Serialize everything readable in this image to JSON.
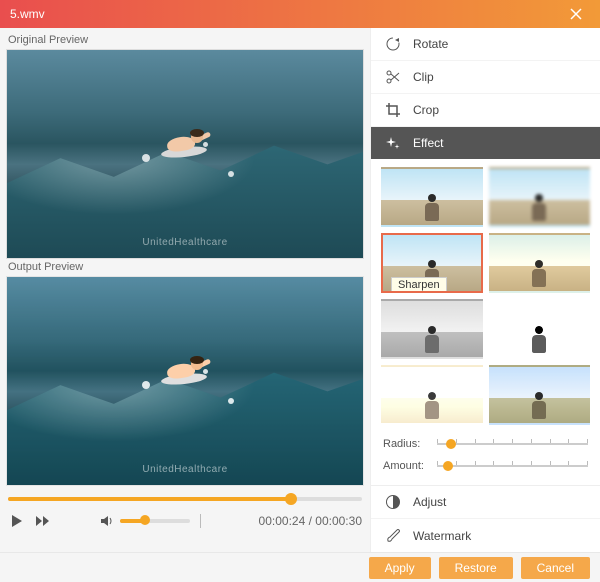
{
  "titlebar": {
    "title": "5.wmv"
  },
  "previews": {
    "original_label": "Original Preview",
    "output_label": "Output Preview",
    "watermark": "UnitedHealthcare"
  },
  "playback": {
    "current": "00:00:24",
    "total": "00:00:30",
    "sep": " / "
  },
  "tabs": {
    "rotate": "Rotate",
    "clip": "Clip",
    "crop": "Crop",
    "effect": "Effect",
    "adjust": "Adjust",
    "watermark": "Watermark"
  },
  "effect": {
    "tooltip": "Sharpen",
    "radius_label": "Radius:",
    "amount_label": "Amount:"
  },
  "footer": {
    "apply": "Apply",
    "restore": "Restore",
    "cancel": "Cancel"
  }
}
